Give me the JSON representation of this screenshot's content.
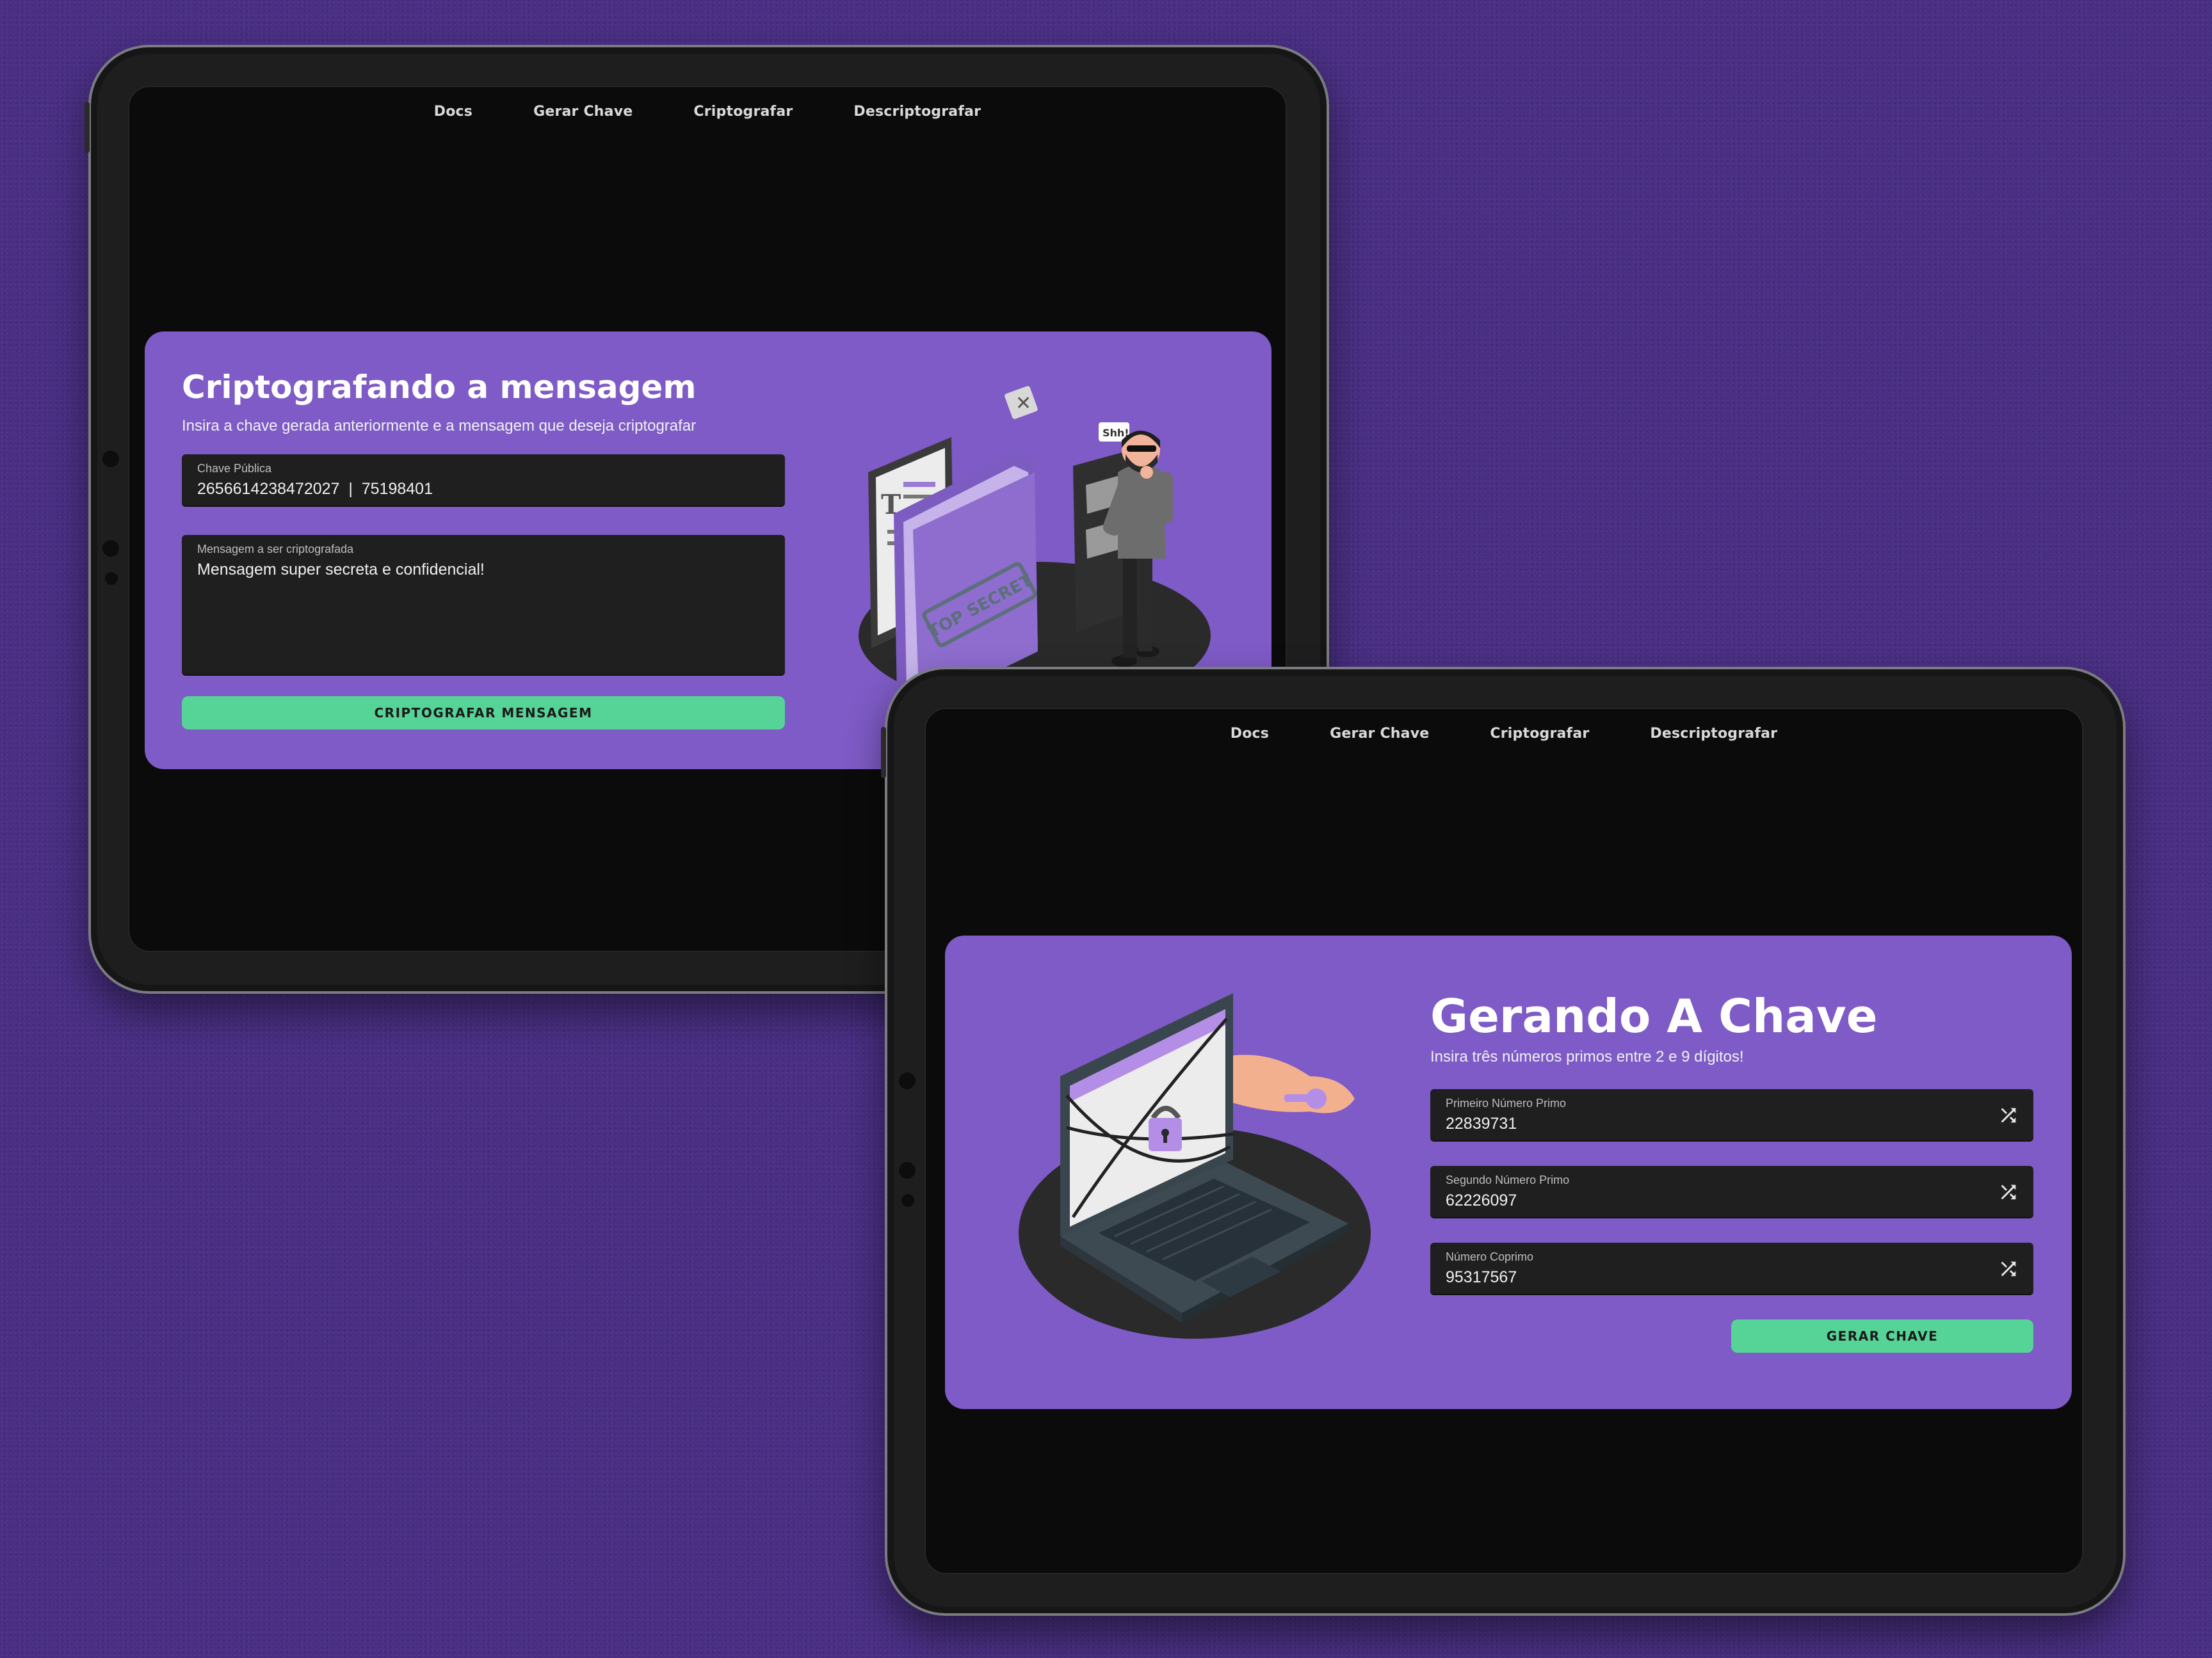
{
  "nav": [
    "Docs",
    "Gerar Chave",
    "Criptografar",
    "Descriptografar"
  ],
  "encrypt": {
    "title": "Criptografando a mensagem",
    "subtitle": "Insira a chave gerada anteriormente e a mensagem que deseja criptografar",
    "public_key_label": "Chave Pública",
    "public_key_value": "2656614238472027  |  75198401",
    "message_label": "Mensagem a ser criptografada",
    "message_value": "Mensagem super secreta e confidencial!",
    "button": "CRIPTOGRAFAR MENSAGEM",
    "illustration_text": "TOP SECRET",
    "speech_bubble": "Shh!"
  },
  "keygen": {
    "title": "Gerando A Chave",
    "subtitle": "Insira três números primos entre 2 e 9 dígitos!",
    "fields": [
      {
        "label": "Primeiro Número Primo",
        "value": "22839731"
      },
      {
        "label": "Segundo Número Primo",
        "value": "62226097"
      },
      {
        "label": "Número Coprimo",
        "value": "95317567"
      }
    ],
    "button": "GERAR CHAVE"
  },
  "colors": {
    "background": "#4a2f84",
    "card": "#7e5bc6",
    "button": "#56d497",
    "screen": "#0b0b0b",
    "field": "#1f1f1f"
  }
}
